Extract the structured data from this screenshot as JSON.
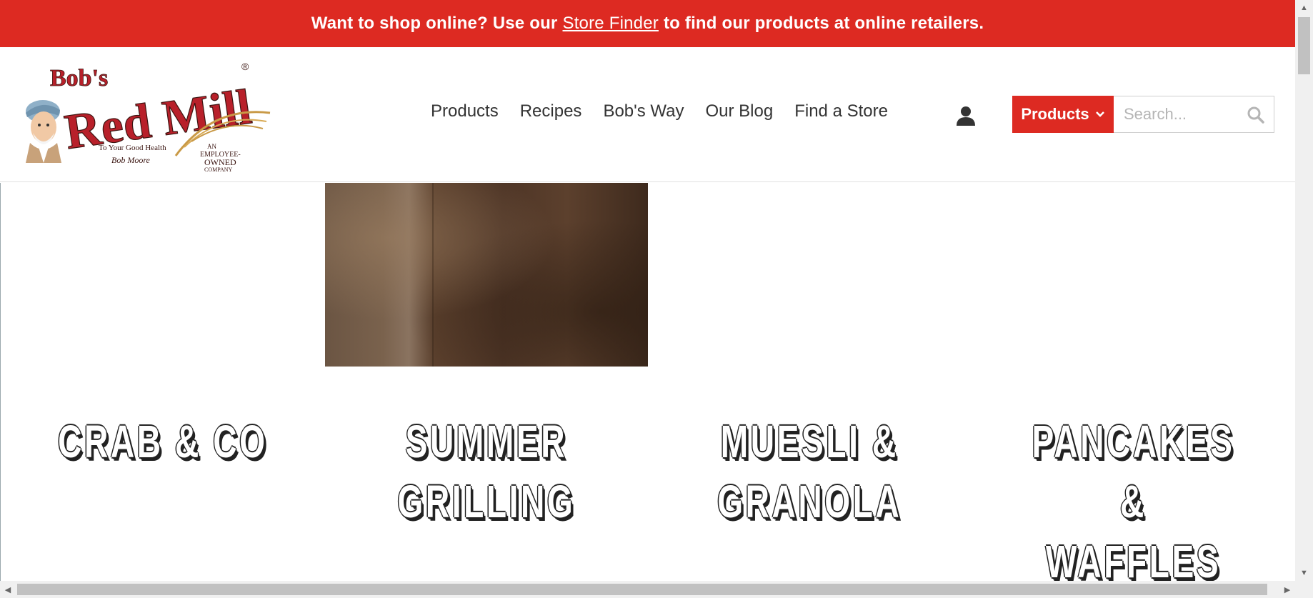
{
  "promo": {
    "text_before": "Want to shop online? Use our",
    "link_text": "Store Finder",
    "text_after": "to find our products at online retailers.",
    "background_color": "#dd2a22"
  },
  "logo": {
    "brand_line_1": "Bob's",
    "brand_line_2": "Red Mill",
    "tagline": "To Your Good Health",
    "signature": "Bob Moore",
    "badge_line_1": "AN",
    "badge_line_2": "EMPLOYEE-",
    "badge_line_3": "OWNED",
    "badge_line_4": "COMPANY",
    "registered": "®"
  },
  "nav": {
    "items": [
      {
        "label": "Products"
      },
      {
        "label": "Recipes"
      },
      {
        "label": "Bob's Way"
      },
      {
        "label": "Our Blog"
      },
      {
        "label": "Find a Store"
      }
    ]
  },
  "account": {
    "icon": "user-icon"
  },
  "search": {
    "category_label": "Products",
    "category_icon": "chevron-down-icon",
    "placeholder": "Search...",
    "value": "",
    "icon": "search-icon"
  },
  "content": {
    "hero_image": "wood-background-image",
    "categories": [
      {
        "title": "CRAB & CO"
      },
      {
        "title": "SUMMER\nGRILLING"
      },
      {
        "title": "MUESLI &\nGRANOLA"
      },
      {
        "title": "PANCAKES &\nWAFFLES"
      }
    ]
  },
  "colors": {
    "brand_red": "#dd2a22",
    "text": "#333333",
    "placeholder": "#b5b5b5"
  }
}
